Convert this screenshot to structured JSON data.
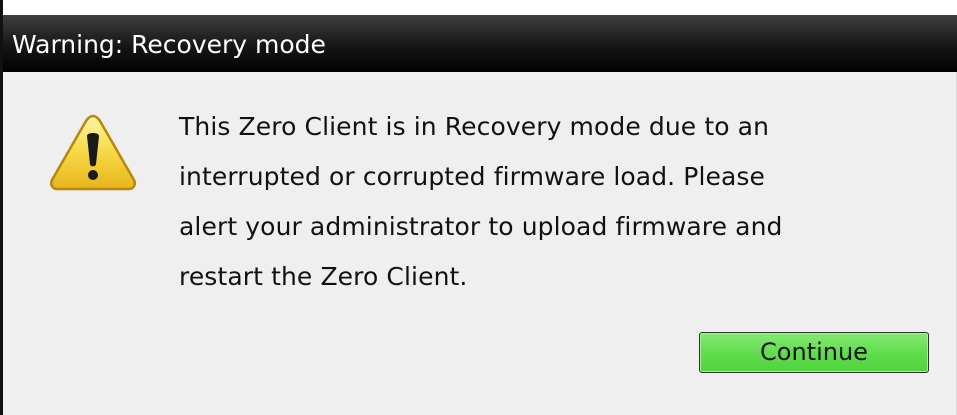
{
  "dialog": {
    "title": "Warning: Recovery mode",
    "icon": "warning-triangle-icon",
    "message_lines": [
      "This Zero Client is in Recovery mode due to an",
      "interrupted or corrupted firmware load. Please",
      "alert your administrator to upload firmware and",
      "restart the Zero Client."
    ],
    "continue_label": "Continue"
  },
  "colors": {
    "titlebar": "#000000",
    "title_text": "#ffffff",
    "body_background": "#efefef",
    "button_green": "#61dd4d",
    "warning_yellow": "#f6d23a"
  }
}
